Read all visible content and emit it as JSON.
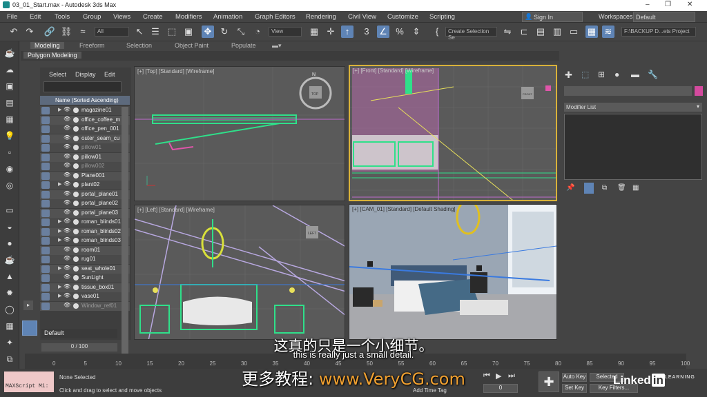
{
  "window": {
    "title": "03_01_Start.max - Autodesk 3ds Max",
    "minimize": "–",
    "restore": "❐",
    "close": "✕"
  },
  "menu": [
    "File",
    "Edit",
    "Tools",
    "Group",
    "Views",
    "Create",
    "Modifiers",
    "Animation",
    "Graph Editors",
    "Rendering",
    "Civil View",
    "Customize",
    "Scripting"
  ],
  "signin": "Sign In",
  "workspaces_label": "Workspaces:",
  "workspace_value": "Default",
  "toolbar": {
    "filter": "All",
    "view": "View",
    "selection_set": "Create Selection Se",
    "project_path": "F:\\BACKUP D...ets Project"
  },
  "ribbon": {
    "tabs": [
      "Modeling",
      "Freeform",
      "Selection",
      "Object Paint",
      "Populate"
    ],
    "active": "Modeling",
    "subtitle": "Polygon Modeling"
  },
  "scene_explorer": {
    "menu": [
      "Select",
      "Display",
      "Edit"
    ],
    "sort_header": "Name (Sorted Ascending)",
    "items": [
      {
        "name": "magazine01",
        "dim": false,
        "arrow": true
      },
      {
        "name": "office_coffee_m",
        "dim": false,
        "arrow": false
      },
      {
        "name": "office_pen_001",
        "dim": false,
        "arrow": false
      },
      {
        "name": "outer_seam_cu",
        "dim": false,
        "arrow": false
      },
      {
        "name": "pillow01",
        "dim": true,
        "arrow": false
      },
      {
        "name": "pillow01",
        "dim": false,
        "arrow": false
      },
      {
        "name": "pillow002",
        "dim": true,
        "arrow": false
      },
      {
        "name": "Plane001",
        "dim": false,
        "arrow": false
      },
      {
        "name": "plant02",
        "dim": false,
        "arrow": true
      },
      {
        "name": "portal_plane01",
        "dim": false,
        "arrow": false
      },
      {
        "name": "portal_plane02",
        "dim": false,
        "arrow": false
      },
      {
        "name": "portal_plane03",
        "dim": false,
        "arrow": false
      },
      {
        "name": "roman_blinds01",
        "dim": false,
        "arrow": true
      },
      {
        "name": "roman_blinds02",
        "dim": false,
        "arrow": true
      },
      {
        "name": "roman_blinds03",
        "dim": false,
        "arrow": true
      },
      {
        "name": "room01",
        "dim": false,
        "arrow": false
      },
      {
        "name": "rug01",
        "dim": false,
        "arrow": false
      },
      {
        "name": "seat_whole01",
        "dim": false,
        "arrow": true
      },
      {
        "name": "SunLight",
        "dim": false,
        "arrow": false
      },
      {
        "name": "tissue_box01",
        "dim": false,
        "arrow": true
      },
      {
        "name": "vase01",
        "dim": false,
        "arrow": true
      },
      {
        "name": "Window_ref01",
        "dim": true,
        "arrow": false
      }
    ],
    "layer": "Default"
  },
  "viewports": {
    "top": "[+] [Top] [Standard] [Wireframe]",
    "front": "[+] [Front] [Standard] [Wireframe]",
    "left": "[+] [Left] [Standard] [Wireframe]",
    "cam": "[+] [CAM_01] [Standard] [Default Shading]",
    "top_cube": "TOP",
    "front_cube": "FRONT",
    "left_cube": "LEFT",
    "compass_n": "N"
  },
  "command_panel": {
    "modifier_list": "Modifier List",
    "colors": {
      "object_color": "#d44a9e"
    }
  },
  "timeline": {
    "frame": "0 / 100",
    "ticks": [
      "0",
      "5",
      "10",
      "15",
      "20",
      "25",
      "30",
      "35",
      "40",
      "45",
      "50",
      "55",
      "60",
      "65",
      "70",
      "75",
      "80",
      "85",
      "90",
      "95",
      "100"
    ]
  },
  "status": {
    "maxscript": "MAXScript Mi:",
    "selected": "None Selected",
    "prompt": "Click and drag to select and move objects",
    "add_time_tag": "Add Time Tag",
    "auto_key": "Auto Key",
    "set_key": "Set Key",
    "selected_dd": "Selected",
    "key_filters": "Key Filters...",
    "frame_spinner": "0"
  },
  "subtitles": {
    "chinese": "这真的只是一个小细节。",
    "english": "this is really just a small detail.",
    "watermark_cn": "更多教程:",
    "watermark_url": "www.VeryCG.com"
  },
  "linkedin": {
    "word": "Linked",
    "in": "in",
    "learning": "LEARNING"
  }
}
